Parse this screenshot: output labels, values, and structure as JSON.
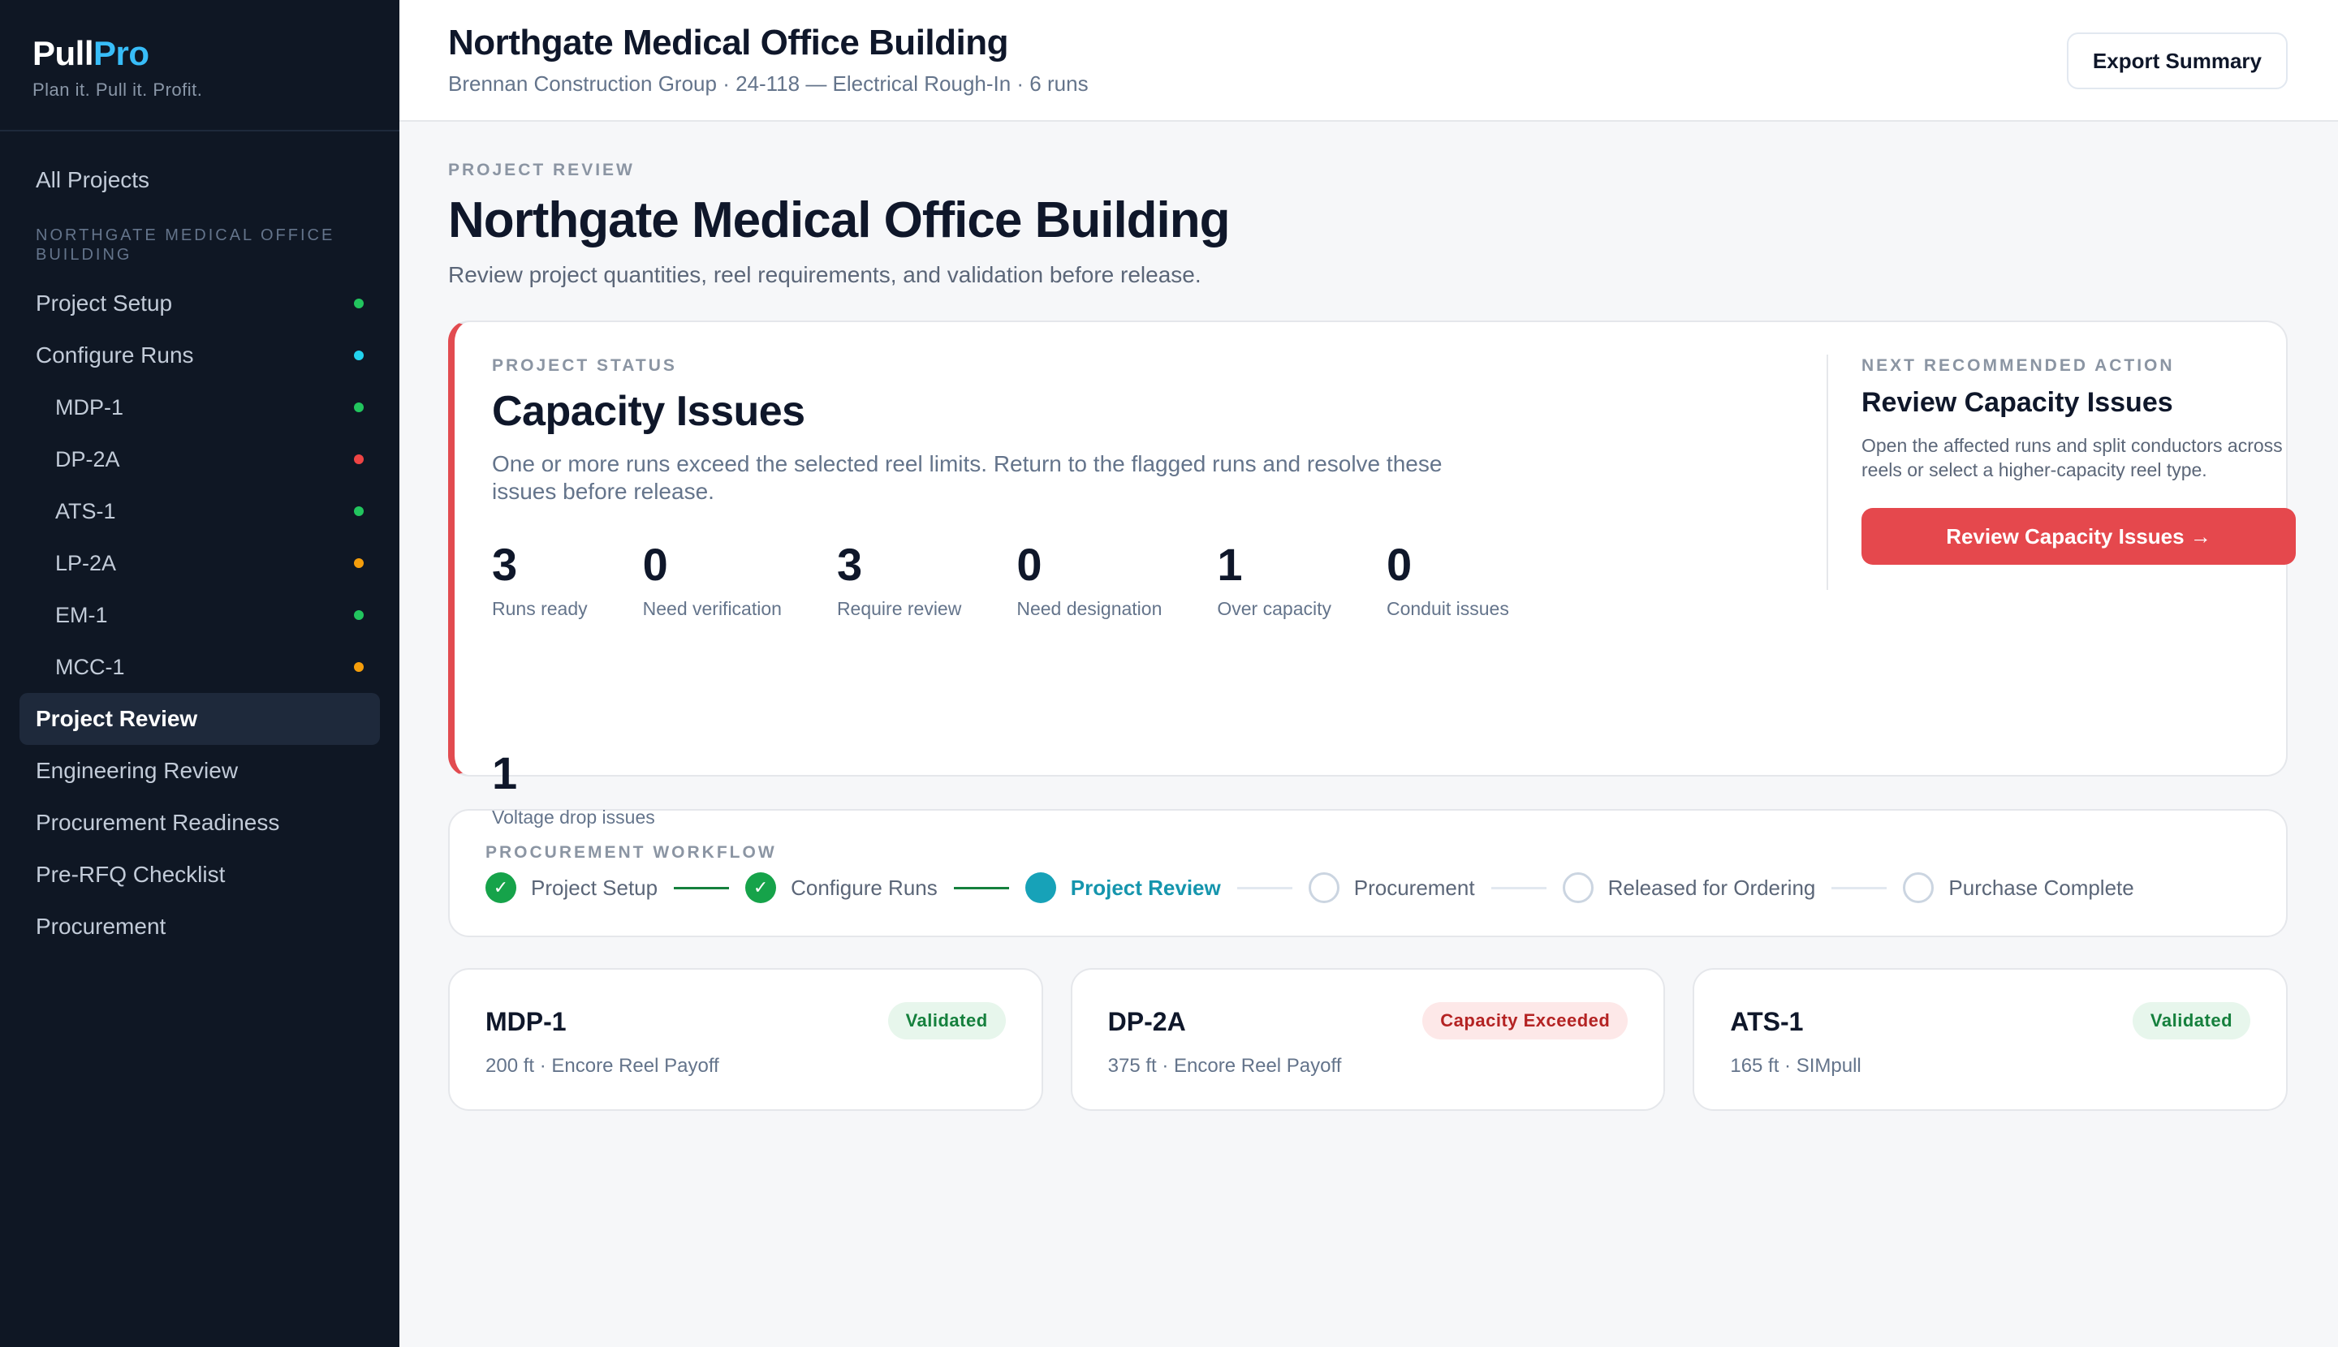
{
  "brand": {
    "name_part1": "Pull",
    "name_part2": "Pro",
    "tagline": "Plan it. Pull it. Profit."
  },
  "sidebar": {
    "all_projects": "All Projects",
    "section_label": "NORTHGATE MEDICAL OFFICE BUILDING",
    "items": [
      {
        "label": "Project Setup",
        "dot": "#22c55e"
      },
      {
        "label": "Configure Runs",
        "dot": "#22d3ee"
      }
    ],
    "runs": [
      {
        "label": "MDP-1",
        "dot": "#22c55e"
      },
      {
        "label": "DP-2A",
        "dot": "#ef4444"
      },
      {
        "label": "ATS-1",
        "dot": "#22c55e"
      },
      {
        "label": "LP-2A",
        "dot": "#f59e0b"
      },
      {
        "label": "EM-1",
        "dot": "#22c55e"
      },
      {
        "label": "MCC-1",
        "dot": "#f59e0b"
      }
    ],
    "active": "Project Review",
    "bottom_items": [
      "Engineering Review",
      "Procurement Readiness",
      "Pre-RFQ Checklist",
      "Procurement"
    ]
  },
  "topbar": {
    "title": "Northgate Medical Office Building",
    "subtitle": "Brennan Construction Group · 24-118 — Electrical Rough-In · 6 runs",
    "export_label": "Export Summary"
  },
  "page": {
    "eyebrow": "PROJECT REVIEW",
    "title": "Northgate Medical Office Building",
    "subtitle": "Review project quantities, reel requirements, and validation before release."
  },
  "status": {
    "eyebrow": "PROJECT STATUS",
    "title": "Capacity Issues",
    "description": "One or more runs exceed the selected reel limits. Return to the flagged runs and resolve these issues before release.",
    "accent_color": "#e24b50",
    "metrics": [
      {
        "value": "3",
        "label": "Runs ready"
      },
      {
        "value": "0",
        "label": "Need verification"
      },
      {
        "value": "3",
        "label": "Require review"
      },
      {
        "value": "0",
        "label": "Need designation"
      },
      {
        "value": "1",
        "label": "Over capacity"
      },
      {
        "value": "0",
        "label": "Conduit issues"
      },
      {
        "value": "1",
        "label": "Voltage drop issues"
      }
    ]
  },
  "next_action": {
    "eyebrow": "NEXT RECOMMENDED ACTION",
    "title": "Review Capacity Issues",
    "description": "Open the affected runs and split conductors across reels or select a higher-capacity reel type.",
    "button_label": "Review Capacity Issues →"
  },
  "workflow": {
    "eyebrow": "PROCUREMENT WORKFLOW",
    "steps": [
      {
        "label": "Project Setup",
        "state": "done"
      },
      {
        "label": "Configure Runs",
        "state": "done"
      },
      {
        "label": "Project Review",
        "state": "current"
      },
      {
        "label": "Procurement",
        "state": "todo"
      },
      {
        "label": "Released for Ordering",
        "state": "todo"
      },
      {
        "label": "Purchase Complete",
        "state": "todo"
      }
    ],
    "check_glyph": "✓"
  },
  "runs": [
    {
      "name": "MDP-1",
      "meta": "200 ft · Encore Reel Payoff",
      "badge": "Validated",
      "status": "ok"
    },
    {
      "name": "DP-2A",
      "meta": "375 ft · Encore Reel Payoff",
      "badge": "Capacity Exceeded",
      "status": "bad"
    },
    {
      "name": "ATS-1",
      "meta": "165 ft · SIMpull",
      "badge": "Validated",
      "status": "ok"
    }
  ]
}
